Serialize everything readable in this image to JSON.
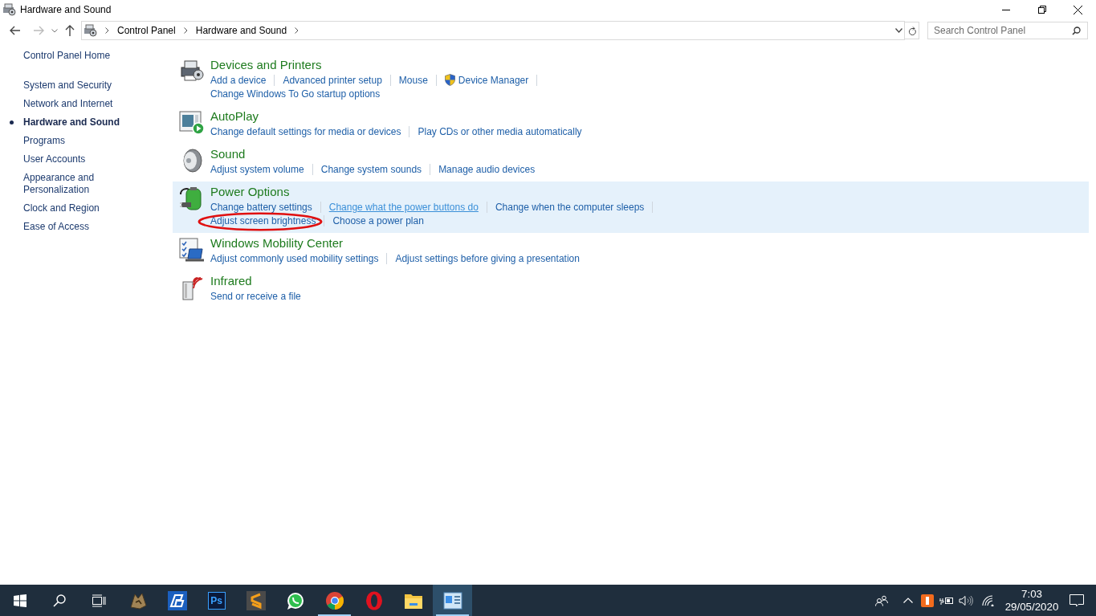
{
  "window": {
    "title": "Hardware and Sound"
  },
  "address": {
    "crumbs": [
      "Control Panel",
      "Hardware and Sound"
    ]
  },
  "search": {
    "placeholder": "Search Control Panel"
  },
  "sidebar": {
    "home": "Control Panel Home",
    "items": [
      {
        "label": "System and Security",
        "selected": false
      },
      {
        "label": "Network and Internet",
        "selected": false
      },
      {
        "label": "Hardware and Sound",
        "selected": true
      },
      {
        "label": "Programs",
        "selected": false
      },
      {
        "label": "User Accounts",
        "selected": false
      },
      {
        "label": "Appearance and Personalization",
        "selected": false
      },
      {
        "label": "Clock and Region",
        "selected": false
      },
      {
        "label": "Ease of Access",
        "selected": false
      }
    ]
  },
  "sections": [
    {
      "kind": "devices",
      "title": "Devices and Printers",
      "highlighted": false,
      "lines": [
        [
          {
            "text": "Add a device",
            "shield": false,
            "hovered": false,
            "circled": false
          },
          {
            "text": "Advanced printer setup",
            "shield": false,
            "hovered": false,
            "circled": false
          },
          {
            "text": "Mouse",
            "shield": false,
            "hovered": false,
            "circled": false
          },
          {
            "text": "Device Manager",
            "shield": true,
            "hovered": false,
            "circled": false
          }
        ],
        [
          {
            "text": "Change Windows To Go startup options",
            "shield": false,
            "hovered": false,
            "circled": false
          }
        ]
      ]
    },
    {
      "kind": "autoplay",
      "title": "AutoPlay",
      "highlighted": false,
      "lines": [
        [
          {
            "text": "Change default settings for media or devices",
            "shield": false,
            "hovered": false,
            "circled": false
          },
          {
            "text": "Play CDs or other media automatically",
            "shield": false,
            "hovered": false,
            "circled": false
          }
        ]
      ]
    },
    {
      "kind": "sound",
      "title": "Sound",
      "highlighted": false,
      "lines": [
        [
          {
            "text": "Adjust system volume",
            "shield": false,
            "hovered": false,
            "circled": false
          },
          {
            "text": "Change system sounds",
            "shield": false,
            "hovered": false,
            "circled": false
          },
          {
            "text": "Manage audio devices",
            "shield": false,
            "hovered": false,
            "circled": false
          }
        ]
      ]
    },
    {
      "kind": "power",
      "title": "Power Options",
      "highlighted": true,
      "lines": [
        [
          {
            "text": "Change battery settings",
            "shield": false,
            "hovered": false,
            "circled": false
          },
          {
            "text": "Change what the power buttons do",
            "shield": false,
            "hovered": true,
            "circled": false
          },
          {
            "text": "Change when the computer sleeps",
            "shield": false,
            "hovered": false,
            "circled": false
          }
        ],
        [
          {
            "text": "Adjust screen brightness",
            "shield": false,
            "hovered": false,
            "circled": true
          },
          {
            "text": "Choose a power plan",
            "shield": false,
            "hovered": false,
            "circled": false
          }
        ]
      ]
    },
    {
      "kind": "mobility",
      "title": "Windows Mobility Center",
      "highlighted": false,
      "lines": [
        [
          {
            "text": "Adjust commonly used mobility settings",
            "shield": false,
            "hovered": false,
            "circled": false
          },
          {
            "text": "Adjust settings before giving a presentation",
            "shield": false,
            "hovered": false,
            "circled": false
          }
        ]
      ]
    },
    {
      "kind": "infrared",
      "title": "Infrared",
      "highlighted": false,
      "lines": [
        [
          {
            "text": "Send or receive a file",
            "shield": false,
            "hovered": false,
            "circled": false
          }
        ]
      ]
    }
  ],
  "taskbar": {
    "apps": [
      {
        "kind": "game",
        "running": false,
        "active": false
      },
      {
        "kind": "pb",
        "running": false,
        "active": false
      },
      {
        "kind": "photoshop",
        "label": "Ps",
        "running": false,
        "active": false
      },
      {
        "kind": "sublime",
        "running": false,
        "active": false
      },
      {
        "kind": "whatsapp",
        "running": false,
        "active": false
      },
      {
        "kind": "chrome",
        "running": true,
        "active": false
      },
      {
        "kind": "opera",
        "running": false,
        "active": false
      },
      {
        "kind": "explorer",
        "running": false,
        "active": false
      },
      {
        "kind": "controlpanel",
        "running": true,
        "active": true
      }
    ],
    "time": "7:03",
    "date": "29/05/2020"
  }
}
